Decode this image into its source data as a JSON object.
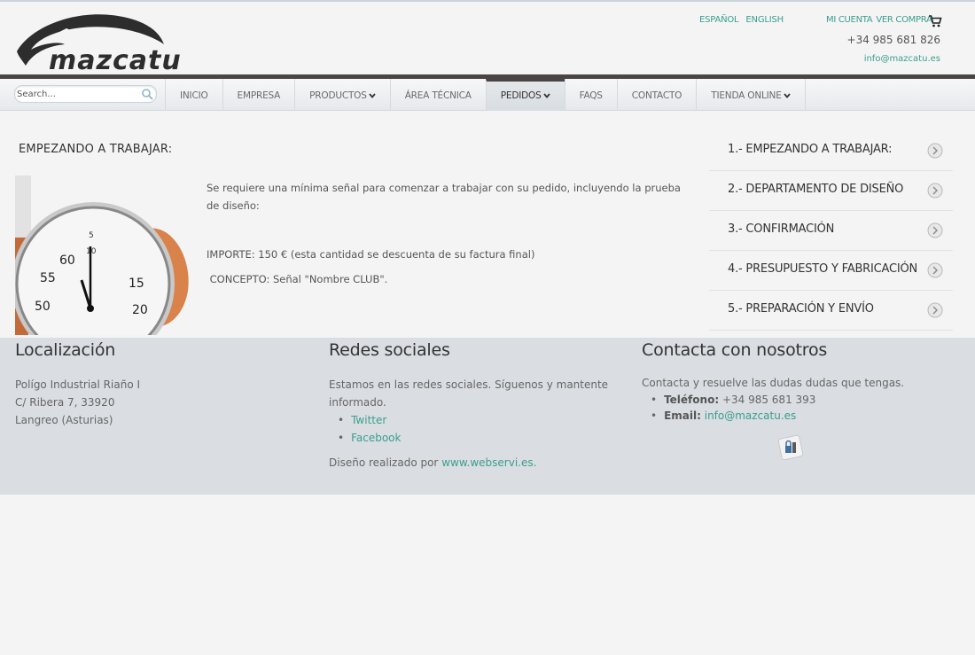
{
  "brand": {
    "logo_text": "mazcatu"
  },
  "header": {
    "languages": [
      "ESPAÑOL",
      "ENGLISH"
    ],
    "account_links": [
      "MI CUENTA",
      "VER COMPRA"
    ],
    "phone": "+34 985 681 826",
    "email": "info@mazcatu.es"
  },
  "search": {
    "placeholder": "Search..."
  },
  "menu": [
    {
      "label": "INICIO",
      "dropdown": false
    },
    {
      "label": "EMPRESA",
      "dropdown": false
    },
    {
      "label": "PRODUCTOS",
      "dropdown": true
    },
    {
      "label": "ÁREA TÉCNICA",
      "dropdown": false
    },
    {
      "label": "PEDIDOS",
      "dropdown": true,
      "active": true
    },
    {
      "label": "FAQS",
      "dropdown": false
    },
    {
      "label": "CONTACTO",
      "dropdown": false
    },
    {
      "label": "TIENDA ONLINE",
      "dropdown": true
    }
  ],
  "main": {
    "heading": "EMPEZANDO A TRABAJAR:",
    "paragraph1": "Se requiere una mínima señal para comenzar a trabajar con su pedido, incluyendo la prueba de diseño:",
    "paragraph2": "IMPORTE: 150 € (esta cantidad se descuenta de su factura final)",
    "paragraph3": " CONCEPTO: Señal \"Nombre CLUB\"."
  },
  "side_menu": [
    "1.- EMPEZANDO A TRABAJAR:",
    "2.- DEPARTAMENTO DE DISEÑO",
    "3.- CONFIRMACIÓN",
    "4.- PRESUPUESTO Y FABRICACIÓN",
    "5.- PREPARACIÓN Y ENVÍO"
  ],
  "footer": {
    "location": {
      "title": "Localización",
      "line1": "Polígo Industrial Riaño I",
      "line2": "C/ Ribera 7, 33920",
      "line3": "Langreo (Asturias)"
    },
    "social": {
      "title": "Redes sociales",
      "text": "Estamos en las redes sociales. Síguenos y mantente informado.",
      "links": [
        "Twitter",
        "Facebook"
      ],
      "credit_prefix": "Diseño realizado por ",
      "credit_link": "www.webservi.es",
      "credit_suffix": "."
    },
    "contact": {
      "title": "Contacta con nosotros",
      "text": "Contacta y resuelve las dudas dudas que tengas.",
      "phone_label": "Teléfono:",
      "phone": " +34 985 681 393",
      "email_label": "Email:",
      "email": "info@mazcatu.es"
    }
  },
  "colors": {
    "accent": "#3a9e8f",
    "dark_bar": "#4a4542",
    "footer_bg": "#dadde2"
  }
}
